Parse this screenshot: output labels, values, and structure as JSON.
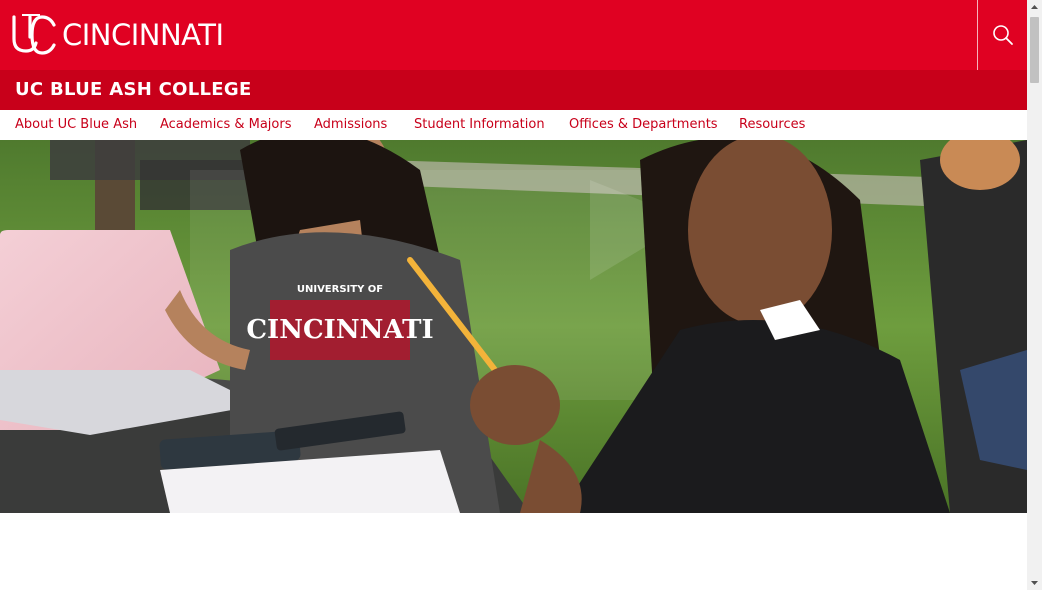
{
  "header": {
    "logo_text": "CINCINNATI",
    "logo_mark": "UC",
    "search_icon": "search-icon"
  },
  "college": {
    "title": "UC BLUE ASH COLLEGE"
  },
  "nav": {
    "items": [
      {
        "label": "About UC Blue Ash"
      },
      {
        "label": "Academics & Majors"
      },
      {
        "label": "Admissions"
      },
      {
        "label": "Student Information"
      },
      {
        "label": "Offices & Departments"
      },
      {
        "label": "Resources"
      }
    ]
  },
  "hero": {
    "shirt_text_top": "UNIVERSITY OF",
    "shirt_text_main": "CINCINNATI"
  },
  "colors": {
    "brand_red": "#e00122",
    "college_bar_red": "#c8001a",
    "nav_link": "#c8001a"
  }
}
